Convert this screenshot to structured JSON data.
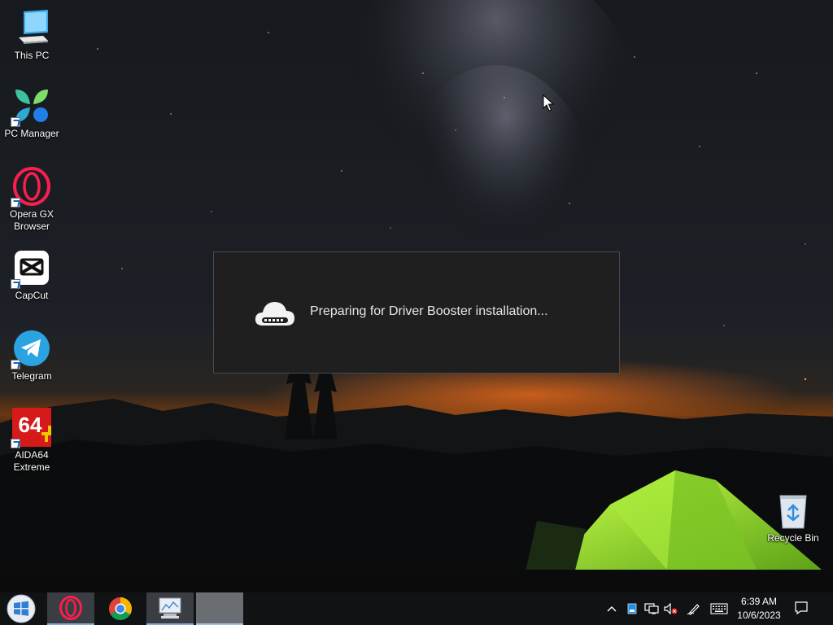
{
  "desktop": {
    "icons": [
      {
        "label": "This PC"
      },
      {
        "label": "PC Manager"
      },
      {
        "label": "Opera GX\nBrowser"
      },
      {
        "label": "CapCut"
      },
      {
        "label": "Telegram"
      },
      {
        "label": "AIDA64\nExtreme"
      },
      {
        "label": "Recycle Bin"
      }
    ],
    "aida_glyph_text": "64"
  },
  "dialog": {
    "message": "Preparing for Driver Booster installation..."
  },
  "taskbar": {
    "clock_time": "6:39 AM",
    "clock_date": "10/6/2023"
  },
  "colors": {
    "taskbar_bg": "#101214",
    "dialog_bg": "#1f1f1f",
    "tent_green": "#8fdc2a"
  }
}
